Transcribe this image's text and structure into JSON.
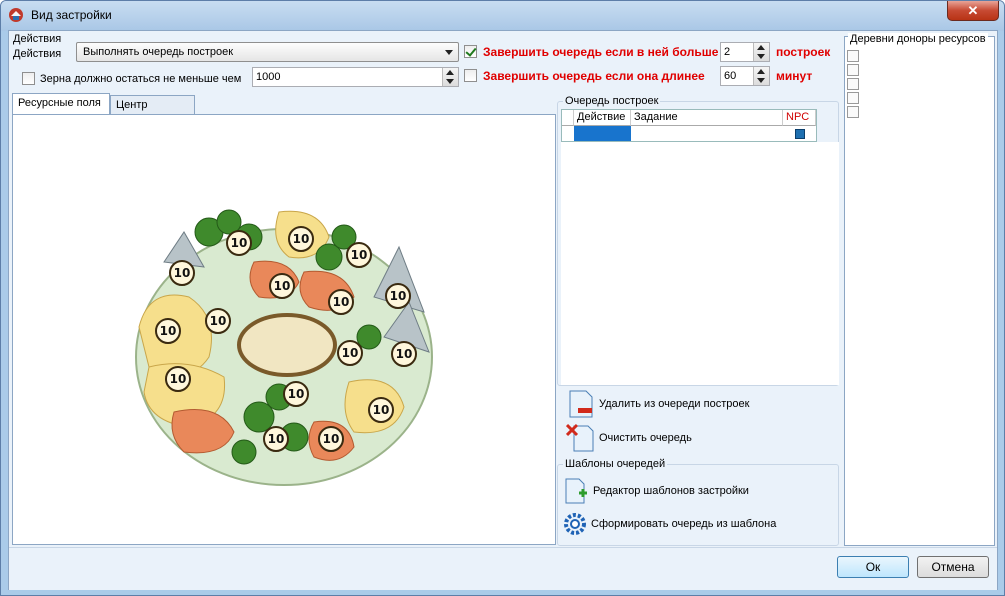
{
  "window": {
    "title": "Вид застройки",
    "close_label": "✕"
  },
  "top": {
    "actions_label_1": "Действия",
    "actions_label_2": "Действия",
    "action_selected": "Выполнять очередь построек",
    "grain_checkbox_label": "Зерна должно остаться не меньше чем",
    "grain_checked": false,
    "grain_value": "1000",
    "finish_if_more_label": "Завершить очередь если в ней больше",
    "finish_if_more_checked": true,
    "finish_if_more_value": "2",
    "finish_if_more_unit": "построек",
    "finish_if_longer_label": "Завершить очередь если она длинее",
    "finish_if_longer_checked": false,
    "finish_if_longer_value": "60",
    "finish_if_longer_unit": "минут"
  },
  "tabs": [
    {
      "label": "Ресурсные поля",
      "active": true
    },
    {
      "label": "Центр деревни",
      "active": false
    }
  ],
  "fields": [
    "10",
    "10",
    "10",
    "10",
    "10",
    "10",
    "10",
    "10",
    "10",
    "10",
    "10",
    "10",
    "10",
    "10",
    "10",
    "10",
    "10",
    "10"
  ],
  "queue": {
    "group_title": "Очередь построек",
    "columns": [
      "Действие",
      "Задание",
      "NPC"
    ],
    "delete_label": "Удалить из очереди построек",
    "clear_label": "Очистить очередь"
  },
  "templates": {
    "group_title": "Шаблоны очередей",
    "editor_label": "Редактор шаблонов застройки",
    "form_label": "Сформировать очередь из шаблона"
  },
  "donors": {
    "title": "Деревни доноры ресурсов"
  },
  "buttons": {
    "ok": "Ок",
    "cancel": "Отмена"
  },
  "colors": {
    "accent_red": "#e00000",
    "selection_blue": "#1874cd",
    "npc_blue": "#1e6fb0"
  }
}
